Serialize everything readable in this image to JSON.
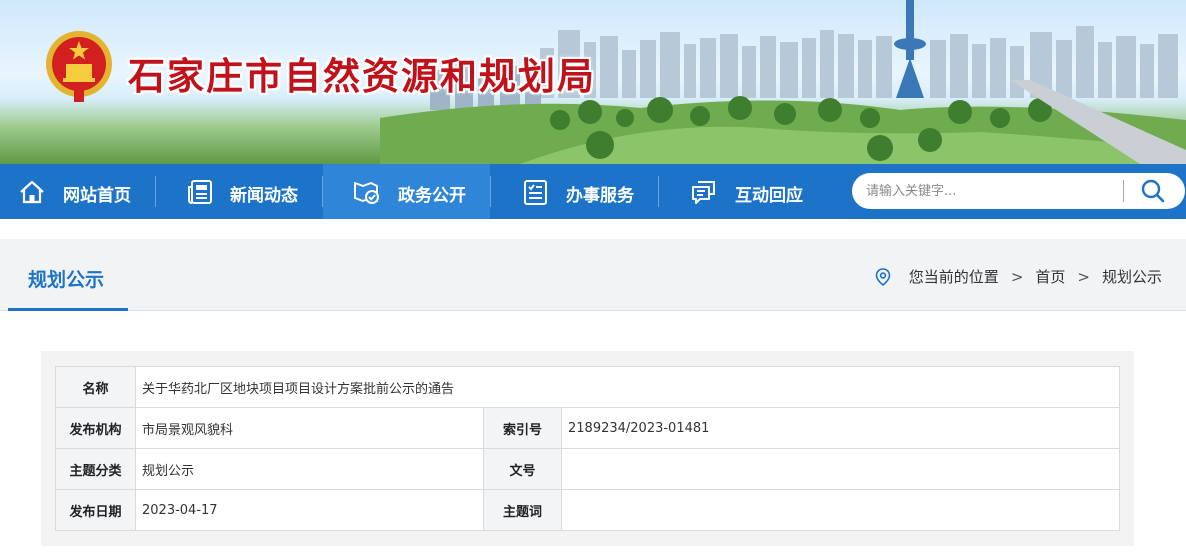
{
  "site": {
    "title": "石家庄市自然资源和规划局"
  },
  "nav": {
    "items": [
      {
        "label": "网站首页",
        "icon": "home-icon"
      },
      {
        "label": "新闻动态",
        "icon": "newspaper-icon"
      },
      {
        "label": "政务公开",
        "icon": "folder-check-icon"
      },
      {
        "label": "办事服务",
        "icon": "checklist-icon"
      },
      {
        "label": "互动回应",
        "icon": "chat-icon"
      }
    ],
    "active": "政务公开"
  },
  "search": {
    "placeholder": "请输入关键字..."
  },
  "section": {
    "title": "规划公示"
  },
  "breadcrumb": {
    "prefix": "您当前的位置",
    "home": "首页",
    "current": "规划公示",
    "separator": ">"
  },
  "info": {
    "name_label": "名称",
    "name_value": "关于华药北厂区地块项目项目设计方案批前公示的通告",
    "org_label": "发布机构",
    "org_value": "市局景观风貌科",
    "index_label": "索引号",
    "index_value": "2189234/2023-01481",
    "topic_label": "主题分类",
    "topic_value": "规划公示",
    "docno_label": "文号",
    "docno_value": "",
    "date_label": "发布日期",
    "date_value": "2023-04-17",
    "keyword_label": "主题词",
    "keyword_value": ""
  },
  "colors": {
    "nav_bg": "#1c73c8",
    "nav_active": "#2f86d8",
    "title_red": "#c0121b",
    "accent": "#1c73c8"
  }
}
